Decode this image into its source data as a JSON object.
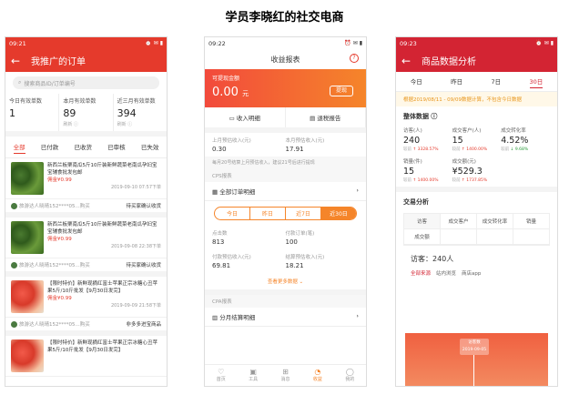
{
  "page_title": "学员李晓红的社交电商",
  "phone1": {
    "status_time": "09:21",
    "status_icons": "⏰ ✉ ▮",
    "nav_title": "我推广的订单",
    "search_placeholder": "搜索商品ID/订单编号",
    "stats": [
      {
        "label": "今日有效单数",
        "value": "1",
        "sub": ""
      },
      {
        "label": "本月有效单数",
        "value": "89",
        "sub": "刷新 ⓘ"
      },
      {
        "label": "近三月有效单数",
        "value": "394",
        "sub": "刷新 ⓘ"
      }
    ],
    "tabs": [
      "全部",
      "已付款",
      "已收货",
      "已审核",
      "已失效"
    ],
    "orders": [
      {
        "text": "新西兰板栗南瓜5斤10斤装新鲜蔬菜老南瓜孕妇宝宝辅食批发包邮",
        "price": "佣金¥0.99",
        "time": "2019-09-10 07:57下单",
        "buyer": "旅游达人晓晴152****05...购买",
        "status": "待买家确认收货"
      },
      {
        "text": "新西兰板栗南瓜5斤10斤装新鲜蔬菜老南瓜孕妇宝宝辅食批发包邮",
        "price": "佣金¥0.99",
        "time": "2019-09-08 22:38下单",
        "buyer": "旅游达人晓晴152****05...购买",
        "status": "待买家确认收货"
      },
      {
        "text": "【限时特价】新鲜现摘红富士苹果正宗冰糖心丑苹果5斤/10斤批发【9月30日发完】",
        "price": "佣金¥0.99",
        "time": "2019-09-09 21:58下单",
        "buyer": "旅游达人晓晴152****05...购买",
        "status": "非多多进宝商品"
      },
      {
        "text": "【限时特价】新鲜现摘红富士苹果正宗冰糖心丑苹果5斤/10斤批发【9月30日发完】",
        "price": "",
        "time": "",
        "buyer": "",
        "status": ""
      }
    ]
  },
  "phone2": {
    "status_time": "09:22",
    "status_icons": "⏰ ✉ ▮",
    "nav_title": "收益报表",
    "help_label": "?",
    "withdraw_label": "可提现金额",
    "withdraw_amount": "0.00",
    "withdraw_unit": "元",
    "withdraw_button": "提现",
    "income_detail": "收入明细",
    "refund_report": "退税报告",
    "last_month_label": "上月预估收入(元)",
    "last_month_value": "0.30",
    "this_month_label": "本月预估收入(元)",
    "this_month_value": "17.91",
    "note": "每月20号结算上月预估收入，建议21号后进行提现",
    "cps_section": "CPS报表",
    "all_orders": "全部订单明细",
    "ranges": [
      "今日",
      "昨日",
      "近7日",
      "近30日"
    ],
    "clicks_label": "点击数",
    "clicks_value": "813",
    "paid_label": "付款订单(笔)",
    "paid_value": "100",
    "paid_est_label": "付款预估收入(元)",
    "paid_est_value": "69.81",
    "settle_est_label": "结算预估收入(元)",
    "settle_est_value": "18.21",
    "more": "查看更多数据 ⌄",
    "cpa_section": "CPA报表",
    "monthly": "分月结算明细",
    "bottom_nav": [
      {
        "icon": "♡",
        "label": "首页"
      },
      {
        "icon": "▣",
        "label": "工具"
      },
      {
        "icon": "⊞",
        "label": "消息"
      },
      {
        "icon": "◔",
        "label": "收益"
      },
      {
        "icon": "◯",
        "label": "我的"
      }
    ]
  },
  "phone3": {
    "status_time": "09:23",
    "status_icons": "⏰ ✉ ▮",
    "nav_title": "商品数据分析",
    "tabs": [
      "今日",
      "昨日",
      "7日",
      "30日"
    ],
    "range_note": "根据2019/08/11 - 09/09数据计算，不包含今日数据",
    "overall": "整体数据 ⓘ",
    "metrics": [
      {
        "label": "访客(人)",
        "value": "240",
        "delta_label": "较前",
        "delta": "↑ 3328.57%",
        "down": false
      },
      {
        "label": "成交客户(人)",
        "value": "15",
        "delta_label": "较前",
        "delta": "↑ 1400.00%",
        "down": false
      },
      {
        "label": "成交转化率",
        "value": "4.52%",
        "delta_label": "较前",
        "delta": "↓ 9.68%",
        "down": true
      },
      {
        "label": "销量(件)",
        "value": "15",
        "delta_label": "较前",
        "delta": "↑ 1400.00%",
        "down": false
      },
      {
        "label": "成交额(元)",
        "value": "¥529.3",
        "delta_label": "较前",
        "delta": "↑ 1737.85%",
        "down": false
      }
    ],
    "trade": "交易分析",
    "table_row1": [
      "访客",
      "成交客户",
      "成交转化率",
      "销量"
    ],
    "table_row2": [
      "成交额",
      "",
      "",
      ""
    ],
    "visitors_line": "访客：240人",
    "sources": [
      "全部来源",
      "站内浏览",
      "商店app"
    ],
    "tip_line1": "访客数",
    "tip_line2": "2019-09-05"
  }
}
